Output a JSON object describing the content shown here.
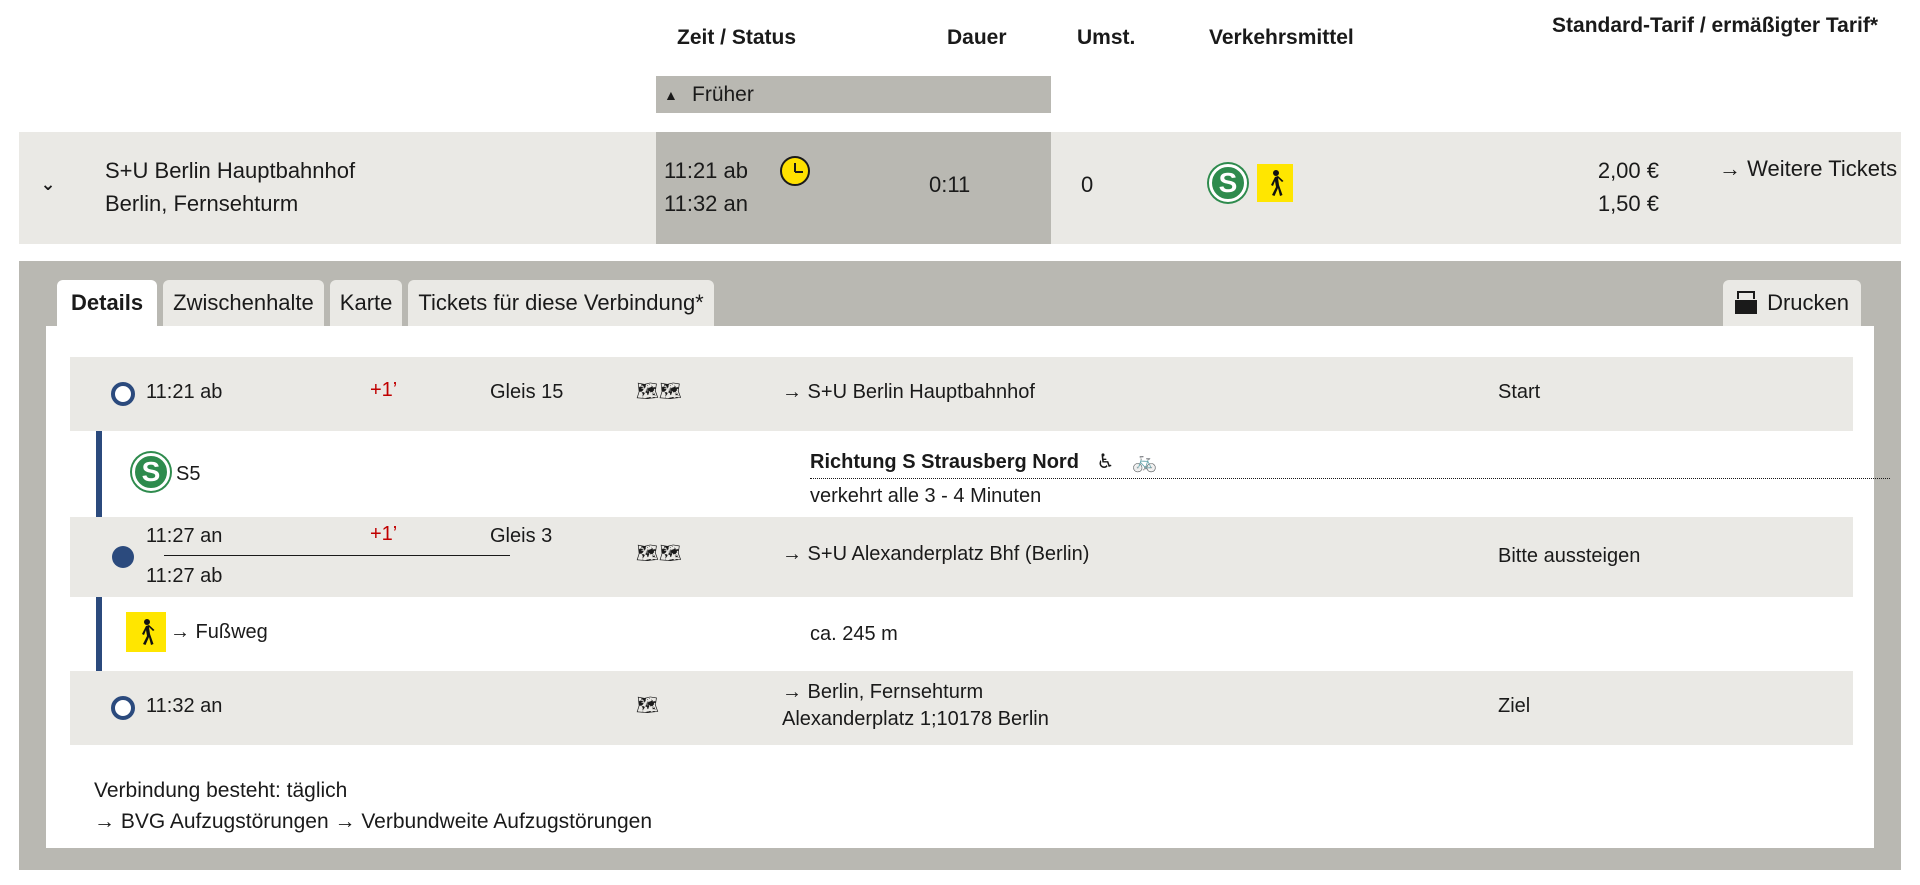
{
  "header": {
    "col_time": "Zeit / Status",
    "col_duration": "Dauer",
    "col_changes": "Umst.",
    "col_transport": "Verkehrsmittel",
    "col_tariff": "Standard-Tarif / ermäßigter Tarif*",
    "earlier_label": "Früher"
  },
  "summary": {
    "from": "S+U Berlin Hauptbahnhof",
    "to": "Berlin, Fernsehturm",
    "dep": "11:21 ab",
    "arr": "11:32 an",
    "duration": "0:11",
    "changes": "0",
    "s_badge": "S",
    "price_standard": "2,00 €",
    "price_reduced": "1,50 €",
    "more_tickets": "→ Weitere Tickets",
    "icons": [
      "chevron-down-icon",
      "clock-icon",
      "s-bahn-icon",
      "walk-icon"
    ]
  },
  "tabs": {
    "details": "Details",
    "stops": "Zwischenhalte",
    "map": "Karte",
    "tickets": "Tickets für diese Verbindung*",
    "print": "Drucken"
  },
  "legs": {
    "start": {
      "time": "11:21 ab",
      "delay": "+1’",
      "platform": "Gleis 15",
      "station": "→ S+U Berlin Hauptbahnhof",
      "note": "Start"
    },
    "ride": {
      "line": "S5",
      "direction": "Richtung S Strausberg Nord",
      "frequency": "verkehrt alle 3 - 4 Minuten"
    },
    "change": {
      "arr_time": "11:27 an",
      "delay": "+1’",
      "dep_time": "11:27 ab",
      "platform": "Gleis 3",
      "station": "→ S+U Alexanderplatz Bhf (Berlin)",
      "note": "Bitte aussteigen"
    },
    "walk": {
      "label": "→ Fußweg",
      "distance": "ca. 245 m"
    },
    "end": {
      "time": "11:32 an",
      "station": "→ Berlin, Fernsehturm",
      "address": "Alexanderplatz 1;10178 Berlin",
      "note": "Ziel"
    }
  },
  "footer": {
    "validity": "Verbindung besteht: täglich",
    "link_bvg": "→ BVG Aufzugstörungen",
    "link_vbb": "→ Verbundweite Aufzugstörungen"
  },
  "colors": {
    "route_line": "#2b4a7d",
    "delay": "#c00000",
    "sbahn": "#2e8b4d",
    "walk_bg": "#ffe600",
    "panel_gray": "#b9b8b2",
    "row_gray": "#eae9e5"
  }
}
